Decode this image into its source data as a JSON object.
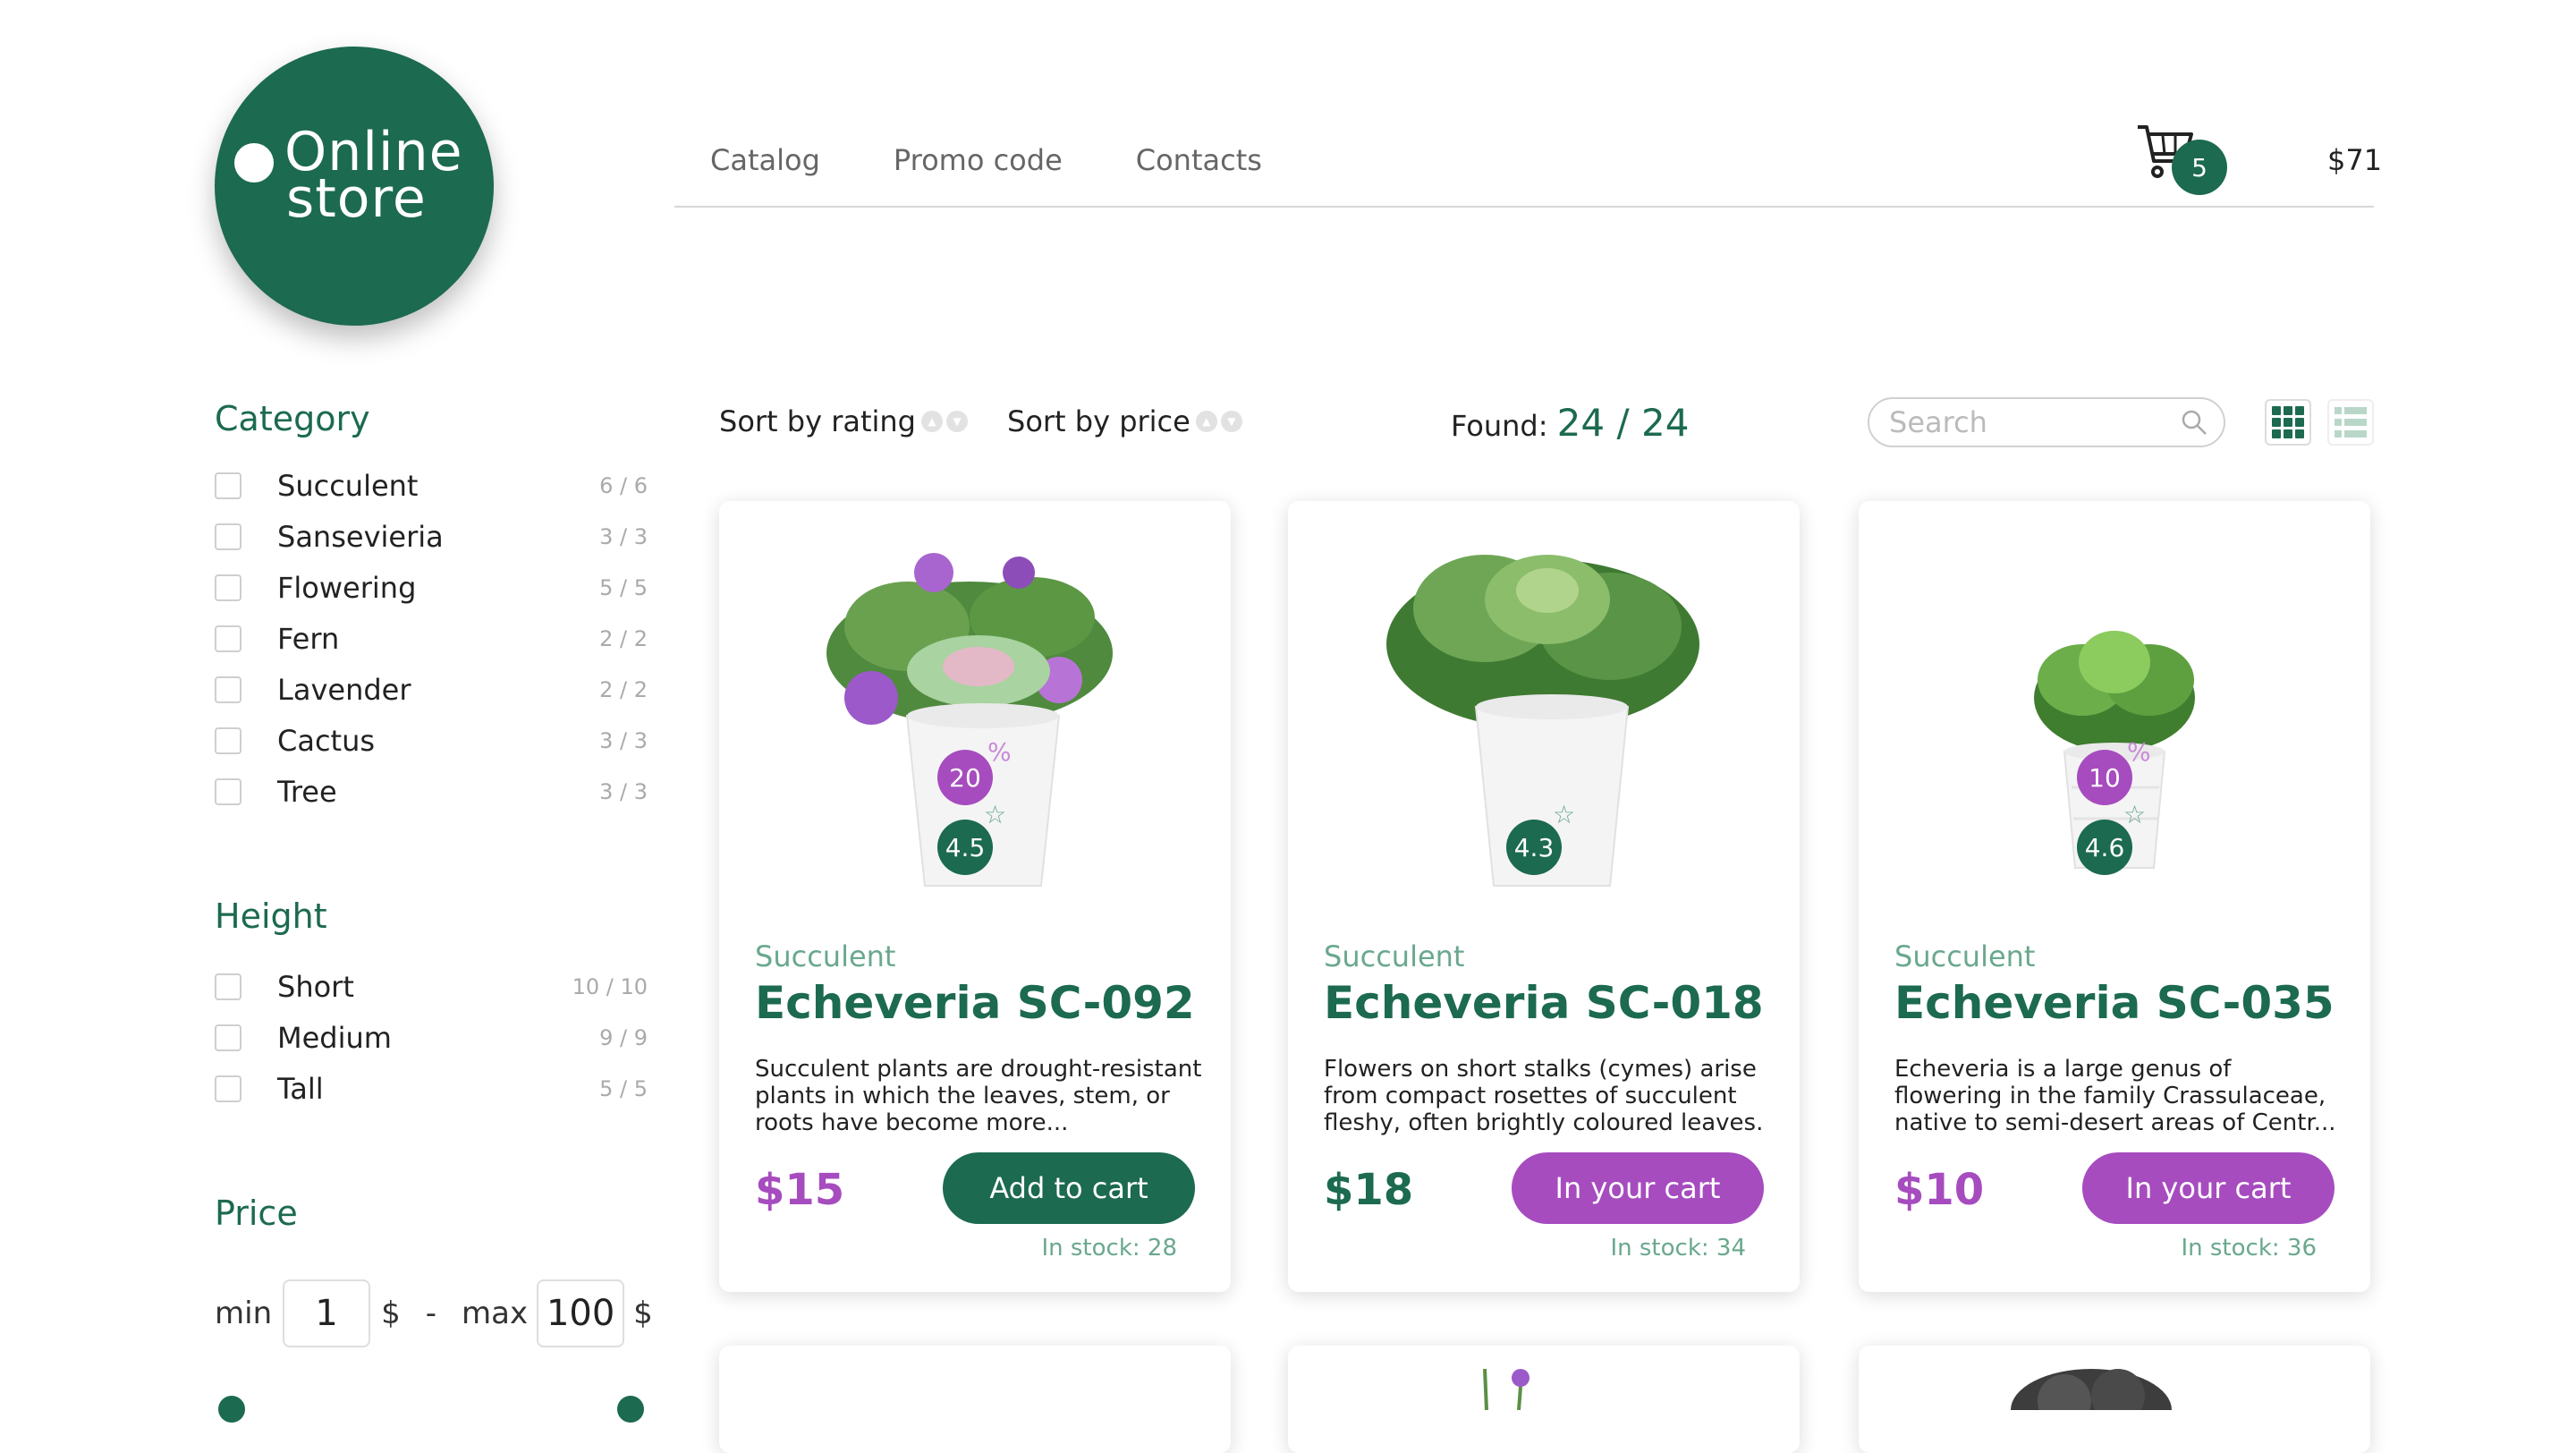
{
  "brand": {
    "line1": "Online",
    "line2": "store"
  },
  "nav": {
    "items": [
      "Catalog",
      "Promo code",
      "Contacts"
    ]
  },
  "cart": {
    "count": "5",
    "total": "$71"
  },
  "sidebar": {
    "category_title": "Category",
    "categories": [
      {
        "label": "Succulent",
        "count": "6 / 6"
      },
      {
        "label": "Sansevieria",
        "count": "3 / 3"
      },
      {
        "label": "Flowering",
        "count": "5 / 5"
      },
      {
        "label": "Fern",
        "count": "2 / 2"
      },
      {
        "label": "Lavender",
        "count": "2 / 2"
      },
      {
        "label": "Cactus",
        "count": "3 / 3"
      },
      {
        "label": "Tree",
        "count": "3 / 3"
      }
    ],
    "height_title": "Height",
    "heights": [
      {
        "label": "Short",
        "count": "10 / 10"
      },
      {
        "label": "Medium",
        "count": "9 / 9"
      },
      {
        "label": "Tall",
        "count": "5 / 5"
      }
    ],
    "price_title": "Price",
    "price": {
      "min_label": "min",
      "min_value": "1",
      "currency": "$",
      "separator": "-",
      "max_label": "max",
      "max_value": "100"
    }
  },
  "toolbar": {
    "sort_rating": "Sort by rating",
    "sort_price": "Sort by price",
    "found_label": "Found:",
    "found_value": "24 / 24",
    "search_placeholder": "Search"
  },
  "products": [
    {
      "category": "Succulent",
      "name": "Echeveria SC-092",
      "description": "Succulent plants are drought-resistant plants in which the leaves, stem, or roots have become more...",
      "price": "$15",
      "button": "Add to cart",
      "stock": "In stock: 28",
      "discount": "20",
      "rating": "4.5",
      "in_cart": false
    },
    {
      "category": "Succulent",
      "name": "Echeveria SC-018",
      "description": "Flowers on short stalks (cymes) arise from compact rosettes of succulent fleshy, often brightly coloured leaves.",
      "price": "$18",
      "button": "In your cart",
      "stock": "In stock: 34",
      "discount": "",
      "rating": "4.3",
      "in_cart": true
    },
    {
      "category": "Succulent",
      "name": "Echeveria SC-035",
      "description": "Echeveria is a large genus of flowering in the family Crassulaceae, native to semi-desert areas of Centr...",
      "price": "$10",
      "button": "In your cart",
      "stock": "In stock: 36",
      "discount": "10",
      "rating": "4.6",
      "in_cart": true
    }
  ],
  "symbols": {
    "percent": "%",
    "star": "☆"
  },
  "colors": {
    "brand_green": "#1c6a4f",
    "accent_purple": "#a64cbf",
    "muted_green": "#6aa88e"
  }
}
